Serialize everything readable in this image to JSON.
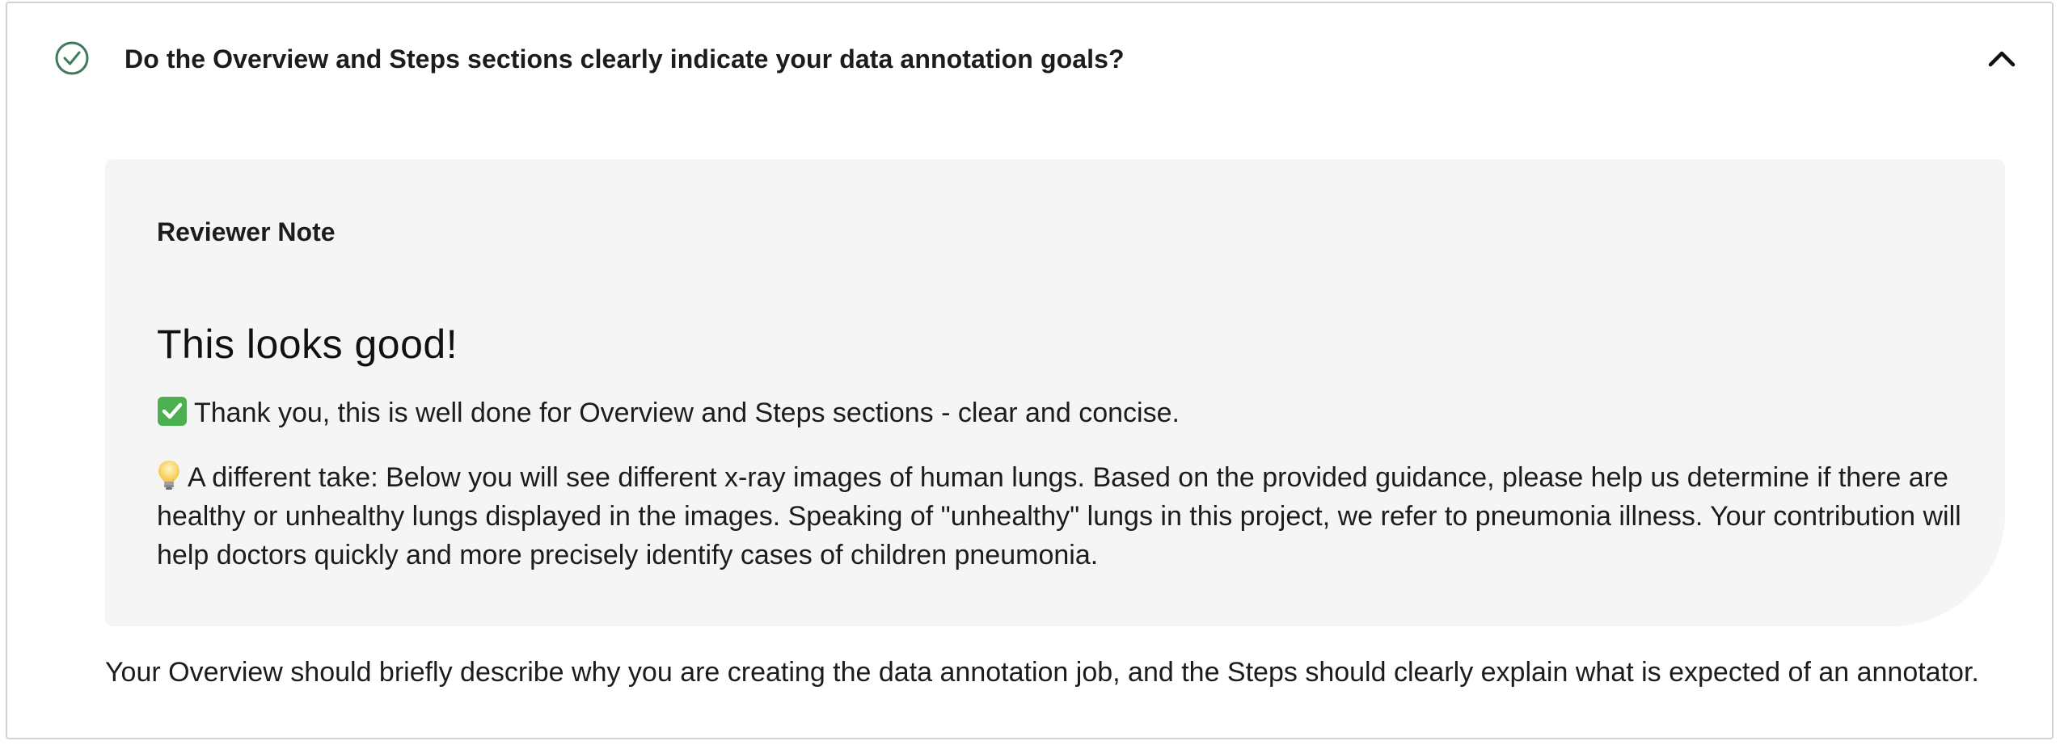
{
  "question": {
    "text": "Do the Overview and Steps sections clearly indicate your data annotation goals?",
    "status_icon": "check-circle-icon",
    "toggle_icon": "chevron-up-icon",
    "accent_color": "#3f7a5a"
  },
  "reviewer_note": {
    "label": "Reviewer Note",
    "heading": "This looks good!",
    "paragraphs": [
      {
        "emoji": "check-mark-button-icon",
        "text": "Thank you, this is well done for Overview and Steps sections - clear and concise."
      },
      {
        "emoji": "light-bulb-icon",
        "text": "A different take: Below you will see different x-ray images of human lungs. Based on the provided guidance, please help us determine if there are healthy or unhealthy lungs displayed in the images. Speaking of \"unhealthy\" lungs in this project, we refer to pneumonia illness. Your contribution will help doctors quickly and more precisely identify cases of children pneumonia."
      }
    ]
  },
  "help_text": "Your Overview should briefly describe why you are creating the data annotation job, and the Steps should clearly explain what is expected of an annotator."
}
